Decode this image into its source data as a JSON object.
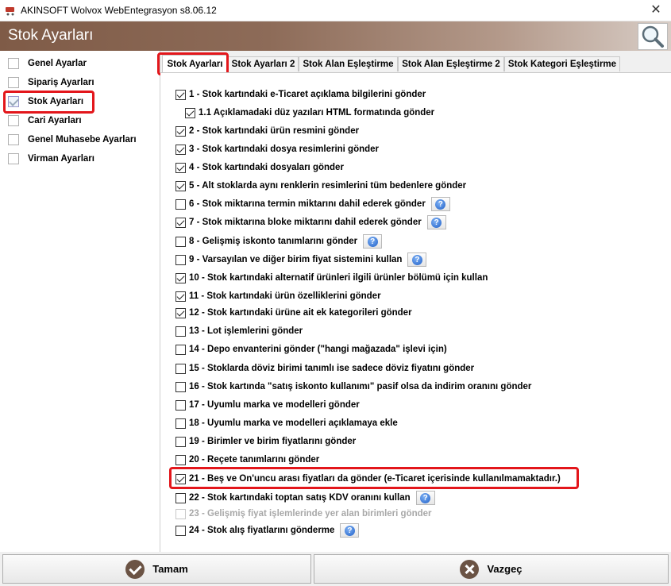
{
  "window": {
    "title": "AKINSOFT Wolvox WebEntegrasyon s8.06.12",
    "close_glyph": "✕"
  },
  "header": {
    "title": "Stok Ayarları",
    "search_icon": "magnifier-icon"
  },
  "sidebar": {
    "items": [
      {
        "label": "Genel Ayarlar",
        "checked": false
      },
      {
        "label": "Sipariş Ayarları",
        "checked": false
      },
      {
        "label": "Stok Ayarları",
        "checked": true,
        "selected": true
      },
      {
        "label": "Cari Ayarları",
        "checked": false
      },
      {
        "label": "Genel Muhasebe Ayarları",
        "checked": false
      },
      {
        "label": "Virman Ayarları",
        "checked": false
      }
    ]
  },
  "tabs": [
    {
      "label": "Stok Ayarları",
      "active": true
    },
    {
      "label": "Stok Ayarları 2",
      "active": false
    },
    {
      "label": "Stok Alan Eşleştirme",
      "active": false
    },
    {
      "label": "Stok Alan Eşleştirme 2",
      "active": false
    },
    {
      "label": "Stok Kategori Eşleştirme",
      "active": false
    }
  ],
  "options": [
    {
      "label": "1 - Stok kartındaki e-Ticaret açıklama bilgilerini gönder",
      "checked": true
    },
    {
      "label": "1.1 Açıklamadaki düz yazıları HTML formatında gönder",
      "checked": true
    },
    {
      "label": "2 - Stok kartındaki ürün resmini gönder",
      "checked": true
    },
    {
      "label": "3 - Stok kartındaki dosya resimlerini gönder",
      "checked": true
    },
    {
      "label": "4 - Stok kartındaki dosyaları gönder",
      "checked": true
    },
    {
      "label": "5 - Alt stoklarda aynı renklerin resimlerini tüm bedenlere gönder",
      "checked": true
    },
    {
      "label": "6 - Stok miktarına termin miktarını dahil ederek gönder",
      "checked": false,
      "help": true
    },
    {
      "label": "7 - Stok miktarına bloke miktarını dahil ederek gönder",
      "checked": true,
      "help": true
    },
    {
      "label": "8 - Gelişmiş iskonto tanımlarını gönder",
      "checked": false,
      "help": true
    },
    {
      "label": "9 - Varsayılan ve diğer birim fiyat sistemini kullan",
      "checked": false,
      "help": true
    },
    {
      "label": "10 - Stok kartındaki alternatif ürünleri ilgili ürünler bölümü için kullan",
      "checked": true
    },
    {
      "label": "11 - Stok kartındaki ürün özelliklerini gönder",
      "checked": true
    },
    {
      "label": "12 - Stok kartındaki ürüne ait ek kategorileri gönder",
      "checked": true
    },
    {
      "label": "13 - Lot işlemlerini gönder",
      "checked": false
    },
    {
      "label": "14 - Depo envanterini gönder (\"hangi mağazada\" işlevi için)",
      "checked": false
    },
    {
      "label": "15 - Stoklarda döviz birimi tanımlı ise sadece döviz fiyatını gönder",
      "checked": false
    },
    {
      "label": "16 - Stok kartında \"satış iskonto kullanımı\" pasif olsa da indirim oranını gönder",
      "checked": false
    },
    {
      "label": "17 - Uyumlu marka ve modelleri gönder",
      "checked": false
    },
    {
      "label": "18 - Uyumlu marka ve modelleri açıklamaya ekle",
      "checked": false
    },
    {
      "label": "19 - Birimler ve birim fiyatlarını gönder",
      "checked": false
    },
    {
      "label": "20 - Reçete tanımlarını gönder",
      "checked": false
    },
    {
      "label": "21 - Beş ve On'uncu arası fiyatları da gönder (e-Ticaret içerisinde kullanılmamaktadır.)",
      "checked": true,
      "highlighted": true
    },
    {
      "label": "22 - Stok kartındaki toptan satış KDV oranını kullan",
      "checked": false,
      "help": true
    },
    {
      "label": "23 - Gelişmiş fiyat işlemlerinde yer alan birimleri gönder",
      "checked": false,
      "disabled": true
    },
    {
      "label": "24 - Stok alış fiyatlarını gönderme",
      "checked": false,
      "help": true
    }
  ],
  "buttons": {
    "ok_label": "Tamam",
    "cancel_label": "Vazgeç"
  },
  "colors": {
    "highlight": "#e3161b",
    "header_brown": "#7f5b47",
    "help_blue": "#1f5fc7"
  }
}
